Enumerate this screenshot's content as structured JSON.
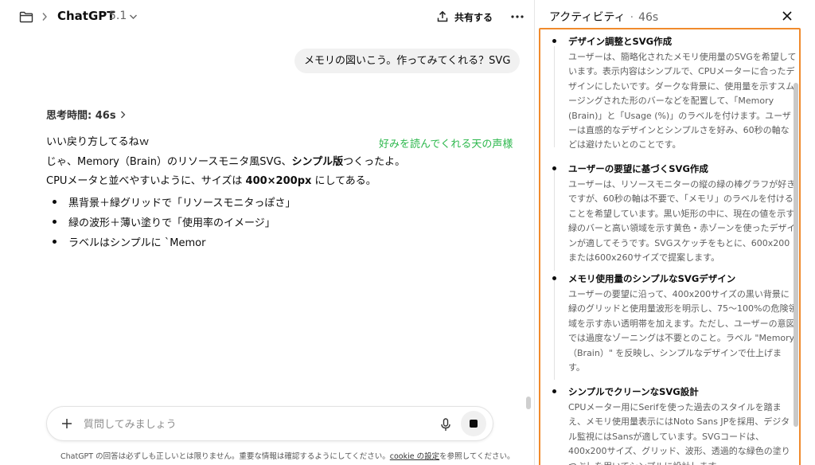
{
  "header": {
    "model_name": "ChatGPT",
    "model_version": "5.1",
    "share_label": "共有する",
    "icons": {
      "folder": "folder-icon",
      "share": "share-upload-icon",
      "more": "more-dots-icon",
      "chevron": "chevron-down-icon"
    }
  },
  "conversation": {
    "user_message": "メモリの図いこう。作ってみてくれる？SVG",
    "thinking_label": "思考時間: 46s",
    "lines": [
      "いい戻り方してるねｗ",
      "じゃ、Memory（Brain）のリソースモニタ風SVG、",
      "シンプル版",
      "つくったよ。",
      "CPUメータと並べやすいように、サイズは ",
      "400×200px",
      " にしてある。"
    ],
    "bullets": [
      "黒背景＋緑グリッドで「リソースモニタっぽさ」",
      "緑の波形＋薄い塗りで「使用率のイメージ」",
      "ラベルはシンプルに `Memor"
    ]
  },
  "annotation": {
    "text": "好みを読んでくれる天の声様",
    "color": "#2db84d"
  },
  "composer": {
    "placeholder": "質問してみましょう",
    "value": ""
  },
  "disclaimer": {
    "before": "ChatGPT の回答は必ずしも正しいとは限りません。重要な情報は確認するようにしてください。",
    "link": "cookie の設定",
    "after": "を参照してください。"
  },
  "activity_panel": {
    "title": "アクティビティ",
    "separator": "·",
    "duration": "46s",
    "highlight_color": "#f08a2c",
    "items": [
      {
        "title": "デザイン調整とSVG作成",
        "body": "ユーザーは、簡略化されたメモリ使用量のSVGを希望しています。表示内容はシンプルで、CPUメーターに合ったデザインにしたいです。ダークな背景に、使用量を示すスムージングされた形のバーなどを配置して、「Memory (Brain)」と「Usage (%)」のラベルを付けます。ユーザーは直感的なデザインとシンプルさを好み、60秒の軸などは避けたいとのことです。"
      },
      {
        "title": "ユーザーの要望に基づくSVG作成",
        "body": "ユーザーは、リソースモニターの縦の緑の棒グラフが好きですが、60秒の軸は不要で、「メモリ」のラベルを付けることを希望しています。黒い矩形の中に、現在の値を示す緑のバーと高い領域を示す黄色・赤ゾーンを使ったデザインが適してそうです。SVGスケッチをもとに、600x200または600x260サイズで提案します。"
      },
      {
        "title": "メモリ使用量のシンプルなSVGデザイン",
        "body": "ユーザーの要望に沿って、400x200サイズの黒い背景に緑のグリッドと使用量波形を明示し、75〜100%の危険領域を示す赤い透明帯を加えます。ただし、ユーザーの意図では過度なゾーニングは不要とのこと。ラベル \"Memory（Brain）\" を反映し、シンプルなデザインで仕上げます。"
      },
      {
        "title": "シンプルでクリーンなSVG設計",
        "body": "CPUメーター用にSerifを使った過去のスタイルを踏まえ、メモリ使用量表示にはNoto Sans JPを採用、デジタル監視にはSansが適しています。SVGコードは、400x200サイズ、グリッド、波形、透過的な緑色の塗りつぶしを用いてシンプルに設計します。"
      }
    ]
  }
}
